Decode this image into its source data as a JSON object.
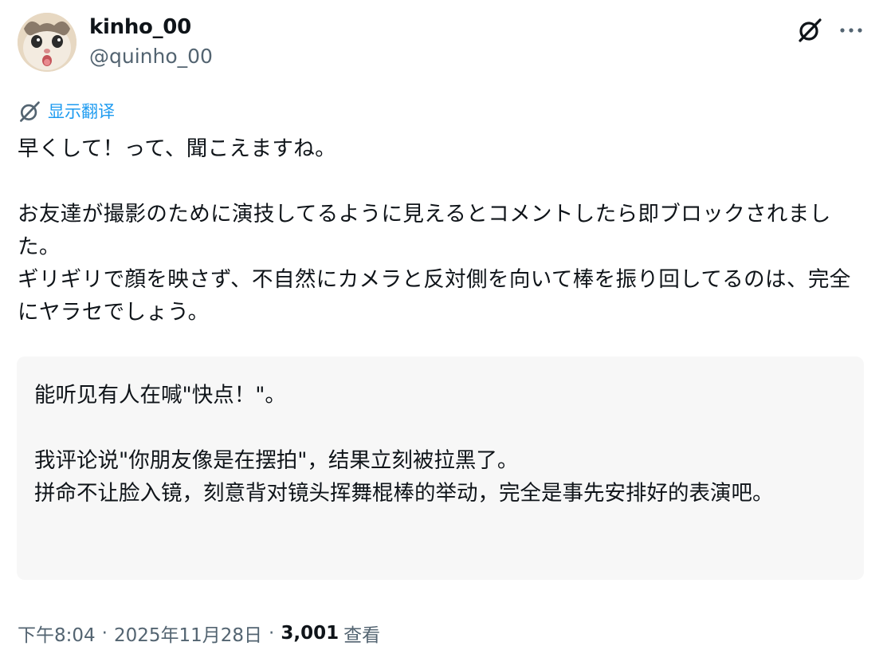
{
  "author": {
    "display_name": "kinho_00",
    "handle": "@quinho_00",
    "avatar_icon": "cat-avatar"
  },
  "header_actions": {
    "grok_icon": "grok-icon",
    "more_icon": "more-horizontal-icon"
  },
  "translate": {
    "icon": "grok-icon",
    "label": "显示翻译",
    "color": "#1d9bf0"
  },
  "tweet": {
    "text": "早くして！って、聞こえますね。\n\nお友達が撮影のために演技してるように見えるとコメントしたら即ブロックされました。\nギリギリで顔を映さず、不自然にカメラと反対側を向いて棒を振り回してるのは、完全にヤラセでしょう。"
  },
  "translation": {
    "text": "能听见有人在喊\"快点！\"。\n\n我评论说\"你朋友像是在摆拍\"，结果立刻被拉黑了。\n拼命不让脸入镜，刻意背对镜头挥舞棍棒的举动，完全是事先安排好的表演吧。"
  },
  "meta": {
    "time": "下午8:04",
    "separator_1": "·",
    "date": "2025年11月28日",
    "separator_2": "·",
    "views_count": "3,001",
    "views_label": "查看"
  }
}
